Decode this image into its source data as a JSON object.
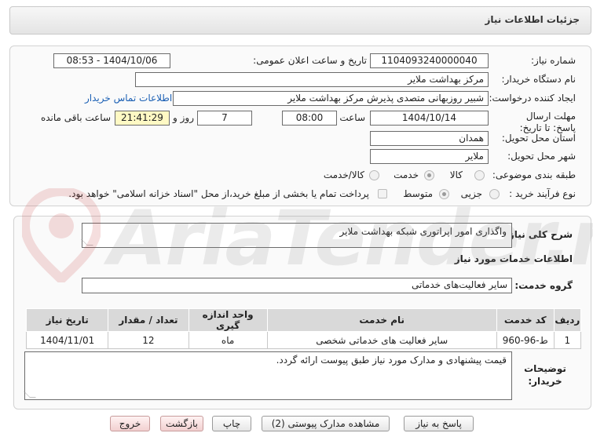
{
  "header": {
    "title": "جزئیات اطلاعات نیاز"
  },
  "form": {
    "need_number_label": "شماره نیاز:",
    "need_number": "1104093240000040",
    "announce_label": "تاریخ و ساعت اعلان عمومی:",
    "announce_value": "1404/10/06 - 08:53",
    "buyer_org_label": "نام دستگاه خریدار:",
    "buyer_org": "مرکز بهداشت ملایر",
    "creator_label": "ایجاد کننده درخواست:",
    "creator": "شبیر روزبهانی متصدی پذیرش مرکز بهداشت ملایر",
    "contact_link": "اطلاعات تماس خریدار",
    "deadline_label": "مهلت ارسال پاسخ: تا تاریخ:",
    "deadline_date": "1404/10/14",
    "time_label": "ساعت",
    "deadline_time": "08:00",
    "days_value": "7",
    "days_label": "روز و",
    "remaining_time": "21:41:29",
    "remaining_label": "ساعت باقی مانده",
    "province_label": "استان محل تحویل:",
    "province": "همدان",
    "city_label": "شهر محل تحویل:",
    "city": "ملایر",
    "category_label": "طبقه بندی موضوعی:",
    "category_options": [
      "کالا",
      "خدمت",
      "کالا/خدمت"
    ],
    "process_label": "نوع فرآیند خرید :",
    "process_options": [
      "جزیی",
      "متوسط"
    ],
    "payment_note": "پرداخت تمام یا بخشی از مبلغ خرید،از محل \"اسناد خزانه اسلامی\" خواهد بود."
  },
  "summary": {
    "label": "شرح کلی نیاز:",
    "value": "واگذاری امور اپراتوری شبکه بهداشت ملایر"
  },
  "services": {
    "section_title": "اطلاعات خدمات مورد نیاز",
    "group_label": "گروه خدمت:",
    "group_value": "سایر فعالیت‌های خدماتی",
    "columns": [
      "ردیف",
      "کد خدمت",
      "نام خدمت",
      "واحد اندازه گیری",
      "تعداد / مقدار",
      "تاریخ نیاز"
    ],
    "rows": [
      {
        "index": "1",
        "code": "ط-96-960",
        "name": "سایر فعالیت های خدماتی شخصی",
        "unit": "ماه",
        "qty": "12",
        "date": "1404/11/01"
      }
    ]
  },
  "buyer_notes": {
    "label": "توضیحات خریدار:",
    "value": "قیمت پیشنهادی و مدارک مورد نیاز طبق پیوست ارائه گردد."
  },
  "buttons": {
    "reply": "پاسخ به نیاز",
    "attachments": "مشاهده مدارک پیوستی (2)",
    "print": "چاپ",
    "back": "بازگشت",
    "exit": "خروج"
  },
  "watermark": {
    "text": "AriaTender.neT"
  },
  "colors": {
    "link": "#1a5fb4",
    "highlight": "#fff9c4",
    "header_bg": "#d9d9d9"
  }
}
